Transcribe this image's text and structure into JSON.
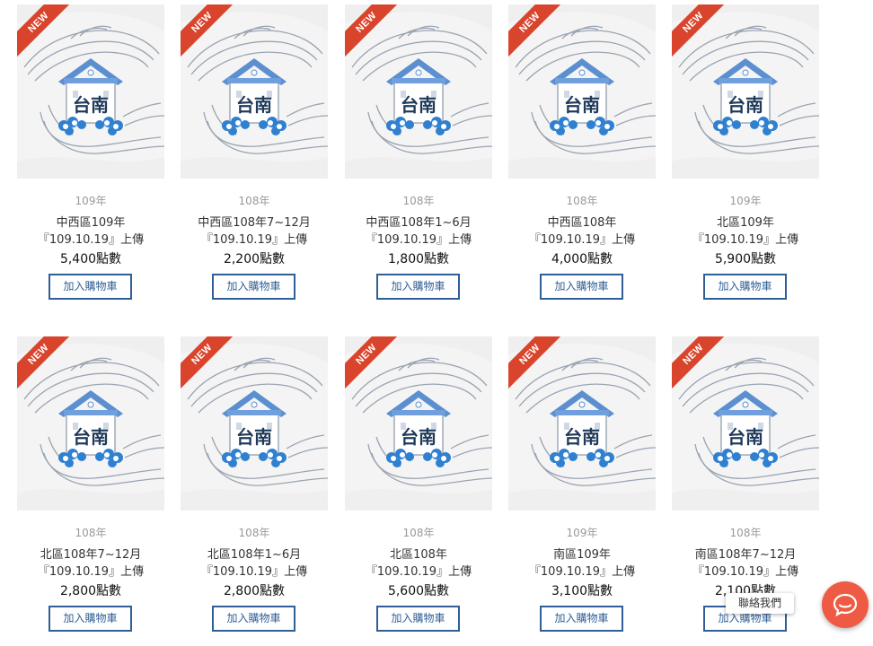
{
  "thumbnail_text": "台南",
  "ribbon_label": "NEW",
  "cart_label": "加入購物車",
  "contact_label": "聯絡我們",
  "colors": {
    "ribbon": "#d9442c",
    "button_border": "#2f5f96",
    "contact": "#ef5a45"
  },
  "products": [
    {
      "year": "109年",
      "title": "中西區109年",
      "upload": "『109.10.19』上傳",
      "points": "5,400點數"
    },
    {
      "year": "108年",
      "title": "中西區108年7~12月",
      "upload": "『109.10.19』上傳",
      "points": "2,200點數"
    },
    {
      "year": "108年",
      "title": "中西區108年1~6月",
      "upload": "『109.10.19』上傳",
      "points": "1,800點數"
    },
    {
      "year": "108年",
      "title": "中西區108年",
      "upload": "『109.10.19』上傳",
      "points": "4,000點數"
    },
    {
      "year": "109年",
      "title": "北區109年",
      "upload": "『109.10.19』上傳",
      "points": "5,900點數"
    },
    {
      "year": "108年",
      "title": "北區108年7~12月",
      "upload": "『109.10.19』上傳",
      "points": "2,800點數"
    },
    {
      "year": "108年",
      "title": "北區108年1~6月",
      "upload": "『109.10.19』上傳",
      "points": "2,800點數"
    },
    {
      "year": "108年",
      "title": "北區108年",
      "upload": "『109.10.19』上傳",
      "points": "5,600點數"
    },
    {
      "year": "109年",
      "title": "南區109年",
      "upload": "『109.10.19』上傳",
      "points": "3,100點數"
    },
    {
      "year": "108年",
      "title": "南區108年7~12月",
      "upload": "『109.10.19』上傳",
      "points": "2,100點數"
    }
  ]
}
